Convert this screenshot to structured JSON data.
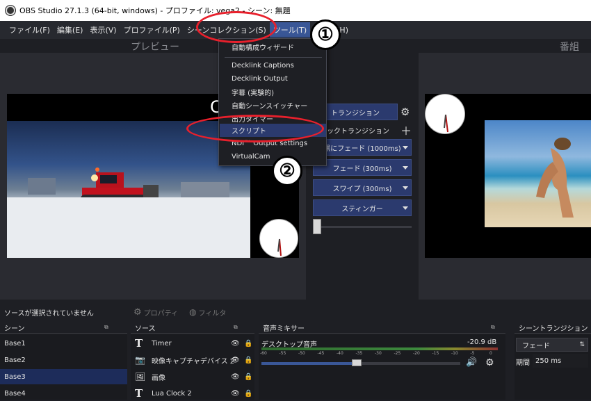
{
  "window": {
    "title": "OBS Studio 27.1.3 (64-bit, windows) - プロファイル: vega2 - シーン: 無題"
  },
  "menubar": {
    "items": [
      "ファイル(F)",
      "編集(E)",
      "表示(V)",
      "プロファイル(P)",
      "シーンコレクション(S)",
      "ツール(T)",
      "ヘルプ(H)"
    ]
  },
  "sections": {
    "preview": "プレビュー",
    "program": "番組"
  },
  "tools_menu": {
    "items": [
      "自動構成ウィザード",
      "Decklink Captions",
      "Decklink Output",
      "字幕 (実験的)",
      "自動シーンスイッチャー",
      "出力タイマー",
      "スクリプト",
      "NDI™ Output settings",
      "VirtualCam"
    ]
  },
  "transitions": {
    "button": "トランジション",
    "quick_label": "クイックトランジション",
    "quick": [
      "黒にフェード (1000ms)",
      "フェード (300ms)",
      "スワイプ (300ms)",
      "スティンガー"
    ],
    "preview_letter": "C"
  },
  "status": {
    "no_source": "ソースが選択されていません",
    "properties": "プロパティ",
    "filters": "フィルタ"
  },
  "docks": {
    "scenes_title": "シーン",
    "sources_title": "ソース",
    "mixer_title": "音声ミキサー",
    "transition_title": "シーントランジション"
  },
  "scenes": [
    "Base1",
    "Base2",
    "Base3",
    "Base4"
  ],
  "selected_scene": "Base3",
  "sources": [
    {
      "name": "Timer",
      "icon": "text-icon"
    },
    {
      "name": "映像キャプチャデバイス 2",
      "icon": "camera-icon"
    },
    {
      "name": "画像",
      "icon": "image-icon"
    },
    {
      "name": "Lua Clock 2",
      "icon": "text-icon"
    }
  ],
  "mixer": {
    "channel": "デスクトップ音声",
    "level": "-20.9 dB",
    "ticks": [
      "-60",
      "-55",
      "-50",
      "-45",
      "-40",
      "-35",
      "-30",
      "-25",
      "-20",
      "-15",
      "-10",
      "-5",
      "0"
    ],
    "volume_fraction": 0.48
  },
  "scene_transition": {
    "selected": "フェード",
    "duration_label": "期間",
    "duration_value": "250 ms"
  },
  "annotations": {
    "one": "①",
    "two": "②"
  },
  "colors": {
    "accent": "#2b3a6e",
    "highlight": "#e8202c",
    "menu_active": "#3a5797"
  }
}
